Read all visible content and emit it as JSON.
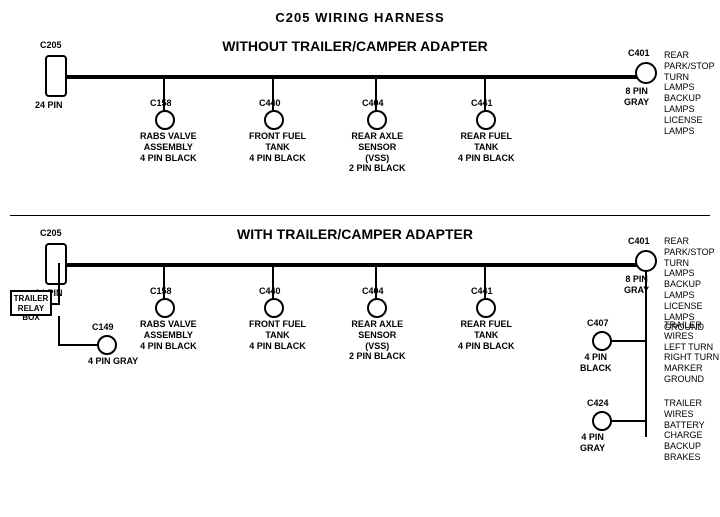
{
  "title": "C205 WIRING HARNESS",
  "section1": {
    "label": "WITHOUT  TRAILER/CAMPER  ADAPTER",
    "connectors": [
      {
        "id": "C205_1",
        "label": "C205",
        "sublabel": "24 PIN",
        "type": "rect"
      },
      {
        "id": "C401_1",
        "label": "C401",
        "sublabel": "8 PIN\nGRAY",
        "rightLabel": "REAR PARK/STOP\nTURN LAMPS\nBACKUP LAMPS\nLICENSE LAMPS"
      },
      {
        "id": "C158_1",
        "label": "C158",
        "sublabel": "RABS VALVE\nASSEMBLY\n4 PIN BLACK"
      },
      {
        "id": "C440_1",
        "label": "C440",
        "sublabel": "FRONT FUEL\nTANK\n4 PIN BLACK"
      },
      {
        "id": "C404_1",
        "label": "C404",
        "sublabel": "REAR AXLE\nSENSOR\n(VSS)\n2 PIN BLACK"
      },
      {
        "id": "C441_1",
        "label": "C441",
        "sublabel": "REAR FUEL\nTANK\n4 PIN BLACK"
      }
    ]
  },
  "section2": {
    "label": "WITH  TRAILER/CAMPER  ADAPTER",
    "connectors": [
      {
        "id": "C205_2",
        "label": "C205",
        "sublabel": "24 PIN",
        "type": "rect"
      },
      {
        "id": "C401_2",
        "label": "C401",
        "sublabel": "8 PIN\nGRAY",
        "rightLabel": "REAR PARK/STOP\nTURN LAMPS\nBACKUP LAMPS\nLICENSE LAMPS\nGROUND"
      },
      {
        "id": "C158_2",
        "label": "C158",
        "sublabel": "RABS VALVE\nASSEMBLY\n4 PIN BLACK"
      },
      {
        "id": "C440_2",
        "label": "C440",
        "sublabel": "FRONT FUEL\nTANK\n4 PIN BLACK"
      },
      {
        "id": "C404_2",
        "label": "C404",
        "sublabel": "REAR AXLE\nSENSOR\n(VSS)\n2 PIN BLACK"
      },
      {
        "id": "C441_2",
        "label": "C441",
        "sublabel": "REAR FUEL\nTANK\n4 PIN BLACK"
      },
      {
        "id": "C149",
        "label": "C149",
        "sublabel": "4 PIN GRAY"
      },
      {
        "id": "C407",
        "label": "C407",
        "sublabel": "4 PIN\nBLACK",
        "rightLabel": "TRAILER WIRES\nLEFT TURN\nRIGHT TURN\nMARKER\nGROUND"
      },
      {
        "id": "C424",
        "label": "C424",
        "sublabel": "4 PIN\nGRAY",
        "rightLabel": "TRAILER WIRES\nBATTERY CHARGE\nBACKUP\nBRAKES"
      }
    ],
    "trailerRelayBox": "TRAILER\nRELAY\nBOX"
  }
}
